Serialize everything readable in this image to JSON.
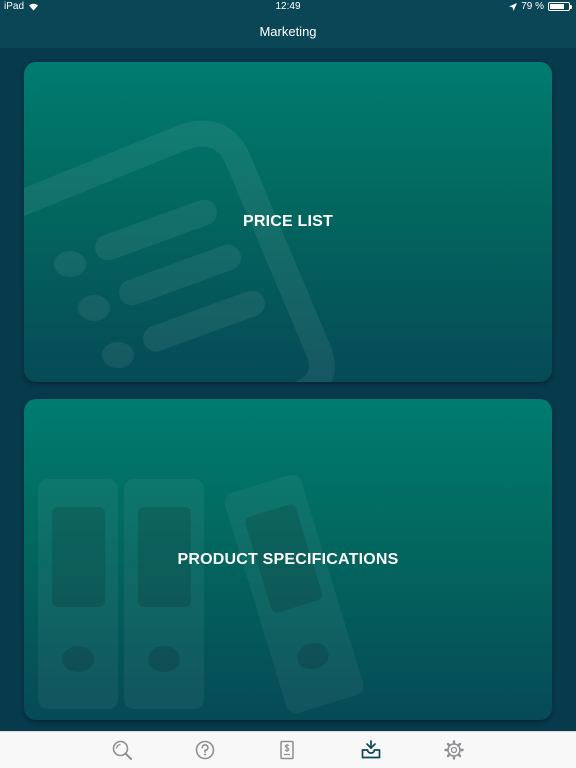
{
  "status_bar": {
    "carrier": "iPad",
    "time": "12:49",
    "battery_text": "79 %",
    "battery_level": 0.79
  },
  "nav": {
    "title": "Marketing"
  },
  "cards": [
    {
      "label": "PRICE LIST",
      "icon": "price-list-document-icon"
    },
    {
      "label": "PRODUCT SPECIFICATIONS",
      "icon": "binders-icon"
    }
  ],
  "tab_bar": {
    "tabs": [
      {
        "icon": "search-icon",
        "selected": false
      },
      {
        "icon": "help-icon",
        "selected": false
      },
      {
        "icon": "price-document-icon",
        "selected": false
      },
      {
        "icon": "inbox-icon",
        "selected": true
      },
      {
        "icon": "settings-gear-icon",
        "selected": false
      }
    ],
    "active_color": "#0a4656",
    "inactive_color": "#8e8e93"
  },
  "colors": {
    "background": "#07394a",
    "nav_bar": "#0a4656",
    "card_top": "#007c70",
    "card_bottom": "#064a56"
  }
}
